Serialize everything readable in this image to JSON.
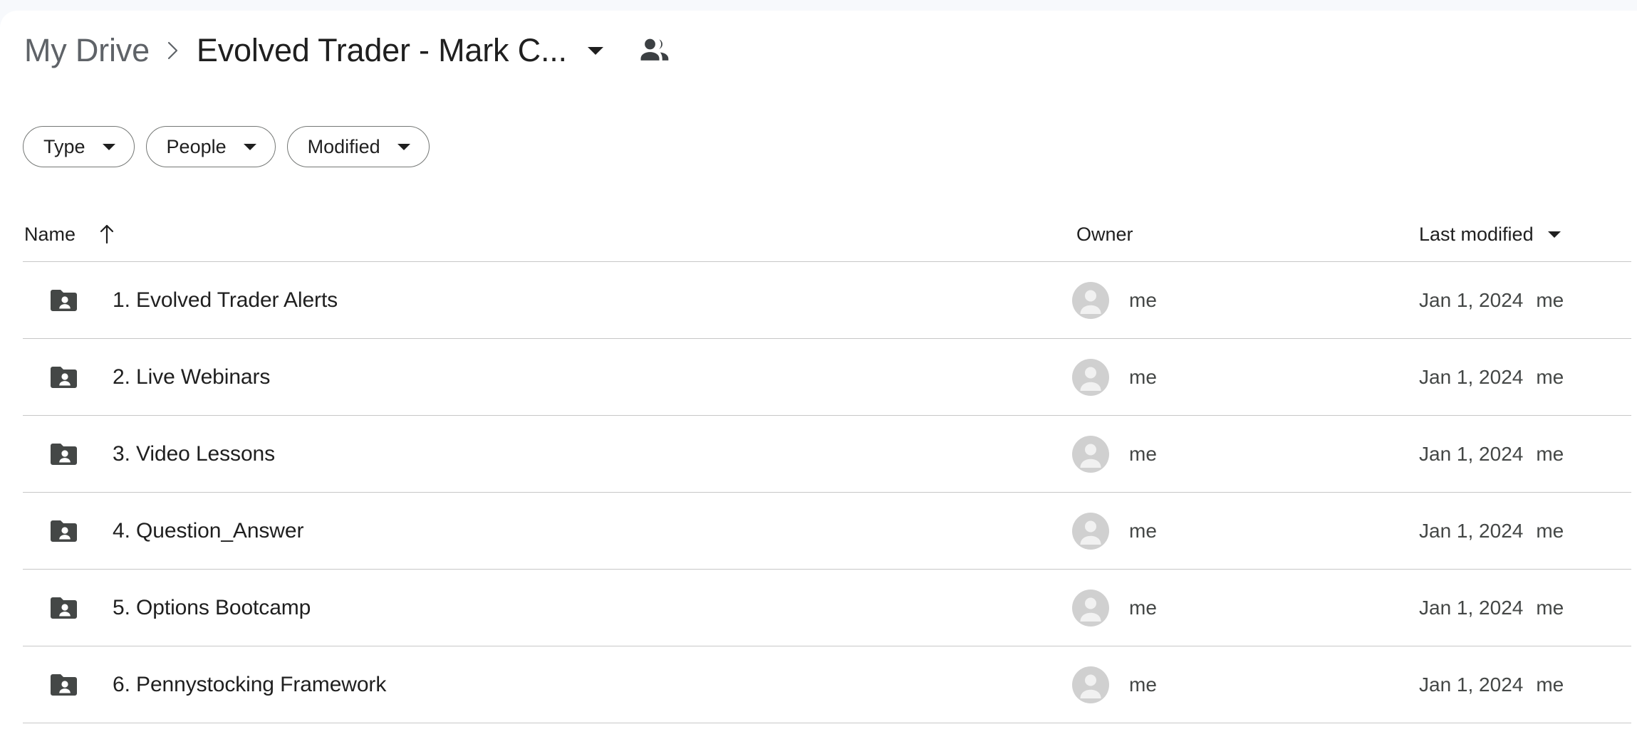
{
  "theme": {
    "backdrop": "#f7f9fc",
    "panel": "#ffffff",
    "text_primary": "#1f1f1f",
    "text_secondary": "#444746",
    "crumb_muted": "#5f6368",
    "divider": "#c7c7c7",
    "chip_border": "#747775",
    "folder_icon": "#444746",
    "avatar_bg": "#d0d0d0"
  },
  "breadcrumb": {
    "root_label": "My Drive",
    "separator": "chevron-right-icon",
    "current_label": "Evolved Trader - Mark C...",
    "caret": "chevron-down-icon",
    "shared_icon": "people-shared-icon"
  },
  "filters": [
    {
      "label": "Type",
      "caret": "chevron-down-icon"
    },
    {
      "label": "People",
      "caret": "chevron-down-icon"
    },
    {
      "label": "Modified",
      "caret": "chevron-down-icon"
    }
  ],
  "table": {
    "columns": {
      "name": {
        "label": "Name",
        "sort_icon": "arrow-up-icon",
        "sorted": "ascending"
      },
      "owner": {
        "label": "Owner"
      },
      "modified": {
        "label": "Last modified",
        "sort_icon": "chevron-down-icon"
      }
    },
    "rows": [
      {
        "icon": "shared-folder-icon",
        "name": "1. Evolved Trader Alerts",
        "owner": "me",
        "avatar": "person-avatar-icon",
        "modified_date": "Jan 1, 2024",
        "modified_by": "me"
      },
      {
        "icon": "shared-folder-icon",
        "name": "2. Live Webinars",
        "owner": "me",
        "avatar": "person-avatar-icon",
        "modified_date": "Jan 1, 2024",
        "modified_by": "me"
      },
      {
        "icon": "shared-folder-icon",
        "name": "3. Video Lessons",
        "owner": "me",
        "avatar": "person-avatar-icon",
        "modified_date": "Jan 1, 2024",
        "modified_by": "me"
      },
      {
        "icon": "shared-folder-icon",
        "name": "4. Question_Answer",
        "owner": "me",
        "avatar": "person-avatar-icon",
        "modified_date": "Jan 1, 2024",
        "modified_by": "me"
      },
      {
        "icon": "shared-folder-icon",
        "name": "5. Options Bootcamp",
        "owner": "me",
        "avatar": "person-avatar-icon",
        "modified_date": "Jan 1, 2024",
        "modified_by": "me"
      },
      {
        "icon": "shared-folder-icon",
        "name": "6. Pennystocking Framework",
        "owner": "me",
        "avatar": "person-avatar-icon",
        "modified_date": "Jan 1, 2024",
        "modified_by": "me"
      }
    ]
  }
}
